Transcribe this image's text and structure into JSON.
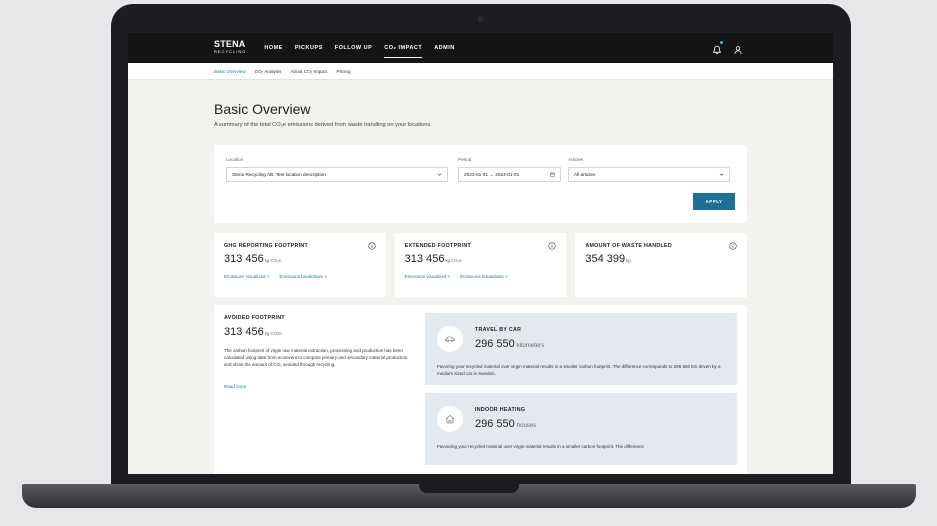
{
  "brand": {
    "name": "STENA",
    "sub": "RECYCLING"
  },
  "nav": {
    "items": [
      "HOME",
      "PICKUPS",
      "FOLLOW UP",
      "CO₂ IMPACT",
      "ADMIN"
    ],
    "active": 3
  },
  "subnav": {
    "items": [
      "Basic Overview",
      "CO₂ Analysis",
      "About CO₂ Impact",
      "Pricing"
    ],
    "active": 0
  },
  "page": {
    "title": "Basic Overview",
    "description": "A summary of the total CO₂e emissions derived from waste handling on your locations."
  },
  "filters": {
    "location_label": "Location",
    "location_value": "Stena Recycling AB, Test location description",
    "period_label": "Period",
    "period_value": "2023-01-01 → 2024-01-01",
    "articles_label": "Articles",
    "articles_value": "All articles",
    "apply_label": "APPLY"
  },
  "stats": [
    {
      "title": "GHG REPORTING FOOTPRINT",
      "value": "313 456",
      "unit": "kg CO₂e",
      "links": [
        "Emissions visualized >",
        "Emissions breakdown >"
      ]
    },
    {
      "title": "EXTENDED FOOTPRINT",
      "value": "313 456",
      "unit": "kg CO₂e",
      "links": [
        "Emissions visualized >",
        "Emissions breakdown >"
      ]
    },
    {
      "title": "AMOUNT OF WASTE HANDLED",
      "value": "354 399",
      "unit": "kg",
      "links": []
    }
  ],
  "avoided": {
    "title": "AVOIDED FOOTPRINT",
    "value": "313 456",
    "unit": "kg CO2e",
    "text": "The carbon footprint of virgin raw material extraction, processing and production has been calculated using data from ecoinvent to compare primary and secondary material production and show the amount of CO₂ avoided through recycling.",
    "read_more": "Read more"
  },
  "equivalents": [
    {
      "icon": "car-icon",
      "title": "TRAVEL BY CAR",
      "value": "296 550",
      "unit": "kilometers",
      "text": "Favoring your recycled material over virgin material results in a smaller carbon footprint. The difference corresponds to 296 550 km driven by a medium sized car in Sweden."
    },
    {
      "icon": "house-icon",
      "title": "INDOOR HEATING",
      "value": "296 550",
      "unit": "houses",
      "text": "Favouring your recycled material over virgin material results in a smaller carbon footprint. The difference"
    }
  ],
  "colors": {
    "accent": "#1d6f93",
    "link": "#1d7aa6",
    "nav_bg": "#141414",
    "equiv_bg": "#e4e9ef"
  }
}
